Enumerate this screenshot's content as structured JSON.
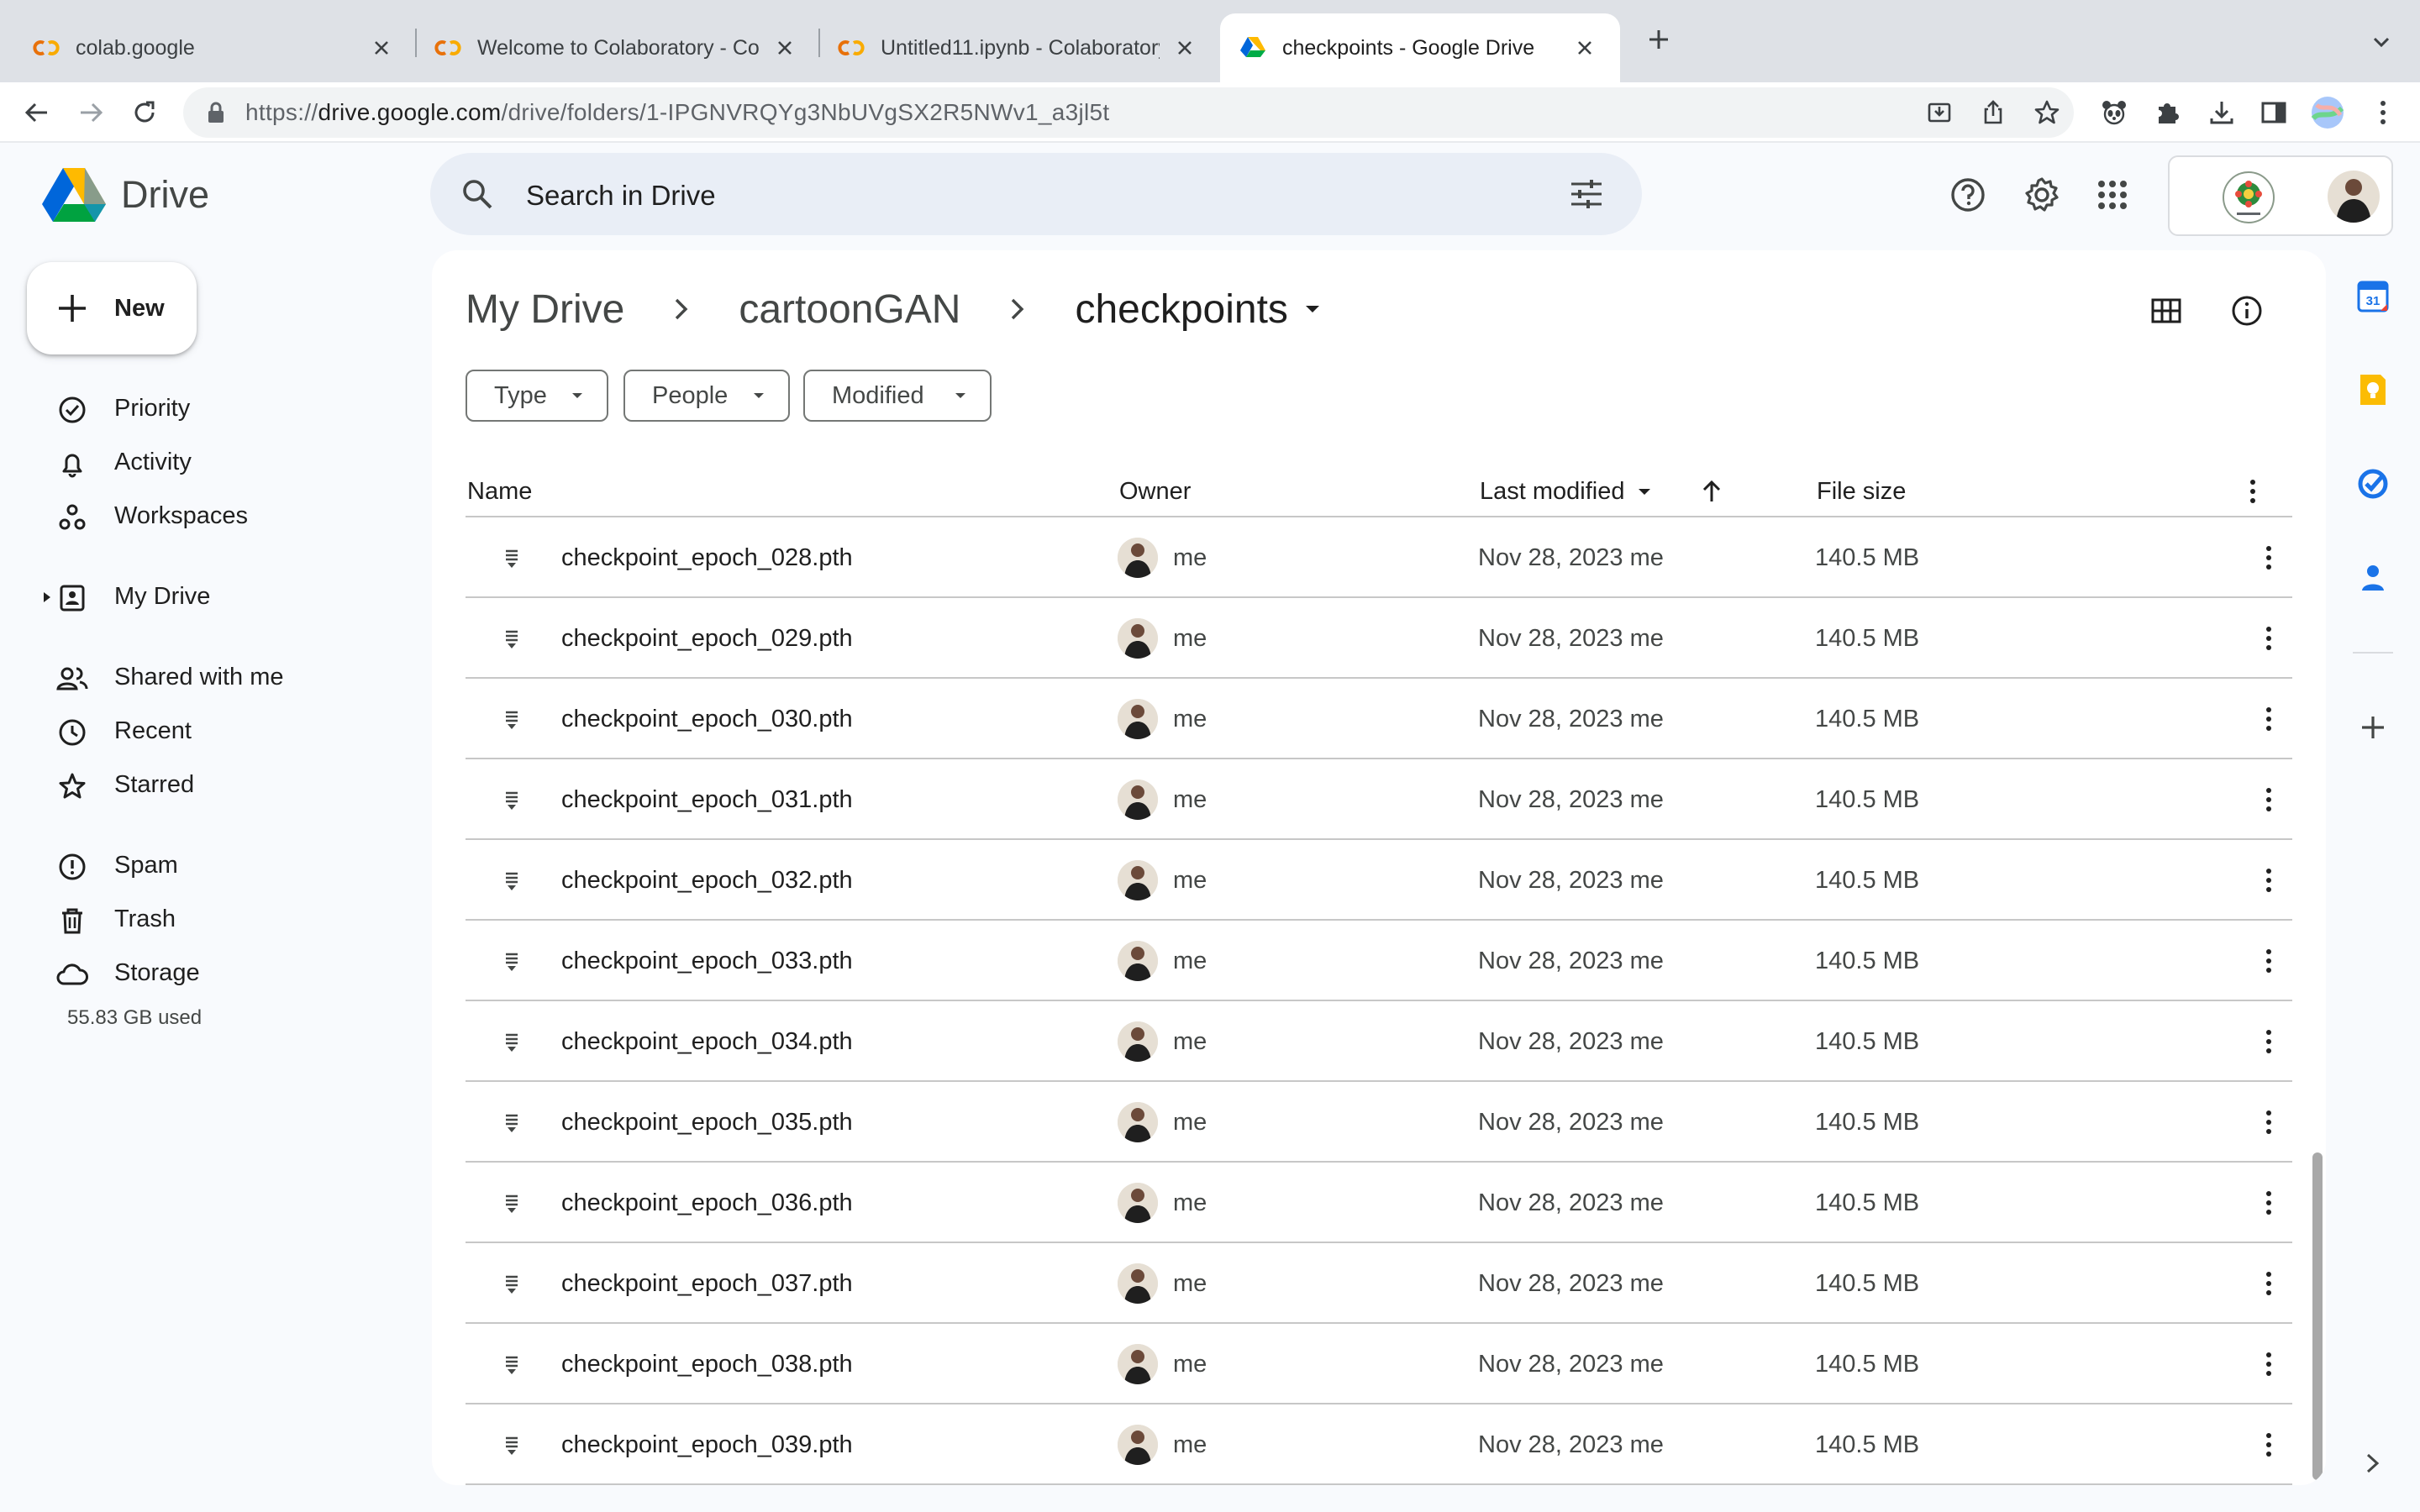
{
  "browser": {
    "tabs": [
      {
        "title": "colab.google",
        "favicon": "colab-icon",
        "active": false
      },
      {
        "title": "Welcome to Colaboratory - Colaboratory",
        "favicon": "colab-icon",
        "active": false
      },
      {
        "title": "Untitled11.ipynb - Colaboratory",
        "favicon": "colab-icon",
        "active": false
      },
      {
        "title": "checkpoints - Google Drive",
        "favicon": "drive-icon",
        "active": true
      }
    ],
    "url_prefix": "https://",
    "url_host": "drive.google.com",
    "url_path": "/drive/folders/1-IPGNVRQYg3NbUVgSX2R5NWv1_a3jl5t"
  },
  "header": {
    "product_name": "Drive",
    "search_placeholder": "Search in Drive"
  },
  "sidebar": {
    "new_label": "New",
    "items": [
      {
        "label": "Priority",
        "icon": "priority-icon"
      },
      {
        "label": "Activity",
        "icon": "bell-icon"
      },
      {
        "label": "Workspaces",
        "icon": "workspaces-icon"
      },
      {
        "label": "My Drive",
        "icon": "my-drive-icon"
      },
      {
        "label": "Shared with me",
        "icon": "people-icon"
      },
      {
        "label": "Recent",
        "icon": "clock-icon"
      },
      {
        "label": "Starred",
        "icon": "star-icon"
      },
      {
        "label": "Spam",
        "icon": "spam-icon"
      },
      {
        "label": "Trash",
        "icon": "trash-icon"
      },
      {
        "label": "Storage",
        "icon": "cloud-icon"
      }
    ],
    "storage_used": "55.83 GB used"
  },
  "main": {
    "breadcrumb": [
      "My Drive",
      "cartoonGAN",
      "checkpoints"
    ],
    "filters": [
      "Type",
      "People",
      "Modified"
    ],
    "columns": {
      "name": "Name",
      "owner": "Owner",
      "last_modified": "Last modified",
      "file_size": "File size"
    },
    "files": [
      {
        "name": "checkpoint_epoch_028.pth",
        "owner": "me",
        "modified": "Nov 28, 2023 me",
        "size": "140.5 MB"
      },
      {
        "name": "checkpoint_epoch_029.pth",
        "owner": "me",
        "modified": "Nov 28, 2023 me",
        "size": "140.5 MB"
      },
      {
        "name": "checkpoint_epoch_030.pth",
        "owner": "me",
        "modified": "Nov 28, 2023 me",
        "size": "140.5 MB"
      },
      {
        "name": "checkpoint_epoch_031.pth",
        "owner": "me",
        "modified": "Nov 28, 2023 me",
        "size": "140.5 MB"
      },
      {
        "name": "checkpoint_epoch_032.pth",
        "owner": "me",
        "modified": "Nov 28, 2023 me",
        "size": "140.5 MB"
      },
      {
        "name": "checkpoint_epoch_033.pth",
        "owner": "me",
        "modified": "Nov 28, 2023 me",
        "size": "140.5 MB"
      },
      {
        "name": "checkpoint_epoch_034.pth",
        "owner": "me",
        "modified": "Nov 28, 2023 me",
        "size": "140.5 MB"
      },
      {
        "name": "checkpoint_epoch_035.pth",
        "owner": "me",
        "modified": "Nov 28, 2023 me",
        "size": "140.5 MB"
      },
      {
        "name": "checkpoint_epoch_036.pth",
        "owner": "me",
        "modified": "Nov 28, 2023 me",
        "size": "140.5 MB"
      },
      {
        "name": "checkpoint_epoch_037.pth",
        "owner": "me",
        "modified": "Nov 28, 2023 me",
        "size": "140.5 MB"
      },
      {
        "name": "checkpoint_epoch_038.pth",
        "owner": "me",
        "modified": "Nov 28, 2023 me",
        "size": "140.5 MB"
      },
      {
        "name": "checkpoint_epoch_039.pth",
        "owner": "me",
        "modified": "Nov 28, 2023 me",
        "size": "140.5 MB"
      }
    ]
  },
  "side_panel": {
    "apps": [
      "calendar-icon",
      "keep-icon",
      "tasks-icon",
      "contacts-icon"
    ],
    "calendar_day": "31"
  },
  "colors": {
    "page_bg": "#f8fafd",
    "search_bg": "#e9eef6",
    "tab_strip_bg": "#dee1e6",
    "divider": "#c7c7c7",
    "accent_blue": "#0b57d0"
  }
}
